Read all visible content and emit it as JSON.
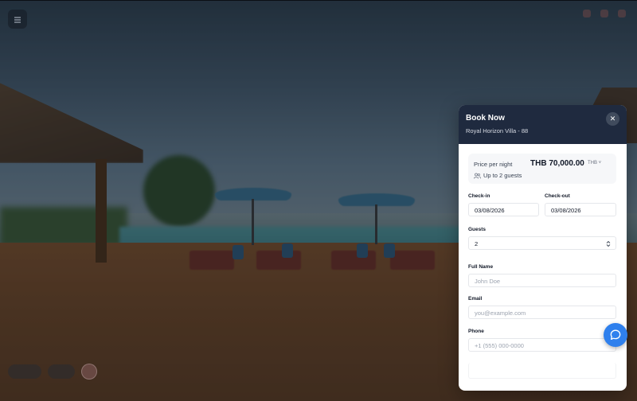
{
  "booking": {
    "title": "Book Now",
    "property_name": "Royal Horizon Villa - 88",
    "close_icon": "close-icon",
    "price_label": "Price per night",
    "price_value": "THB 70,000.00",
    "currency": "THB ˅",
    "guests_note": "Up to 2 guests",
    "checkin_label": "Check-in",
    "checkin_value": "03/08/2026",
    "checkout_label": "Check-out",
    "checkout_value": "03/08/2026",
    "guests_label": "Guests",
    "guests_value": "2",
    "fullname_label": "Full Name",
    "fullname_placeholder": "John Doe",
    "email_label": "Email",
    "email_placeholder": "you@example.com",
    "phone_label": "Phone",
    "phone_placeholder": "+1 (555) 000-0000"
  },
  "icons": {
    "chat": "chat-bubble-icon",
    "users": "users-icon",
    "stepper": "chevron-up-down-icon"
  },
  "colors": {
    "header_bg": "#1f2a3f",
    "accent": "#2f80ed",
    "panel_bg": "#ffffff"
  }
}
